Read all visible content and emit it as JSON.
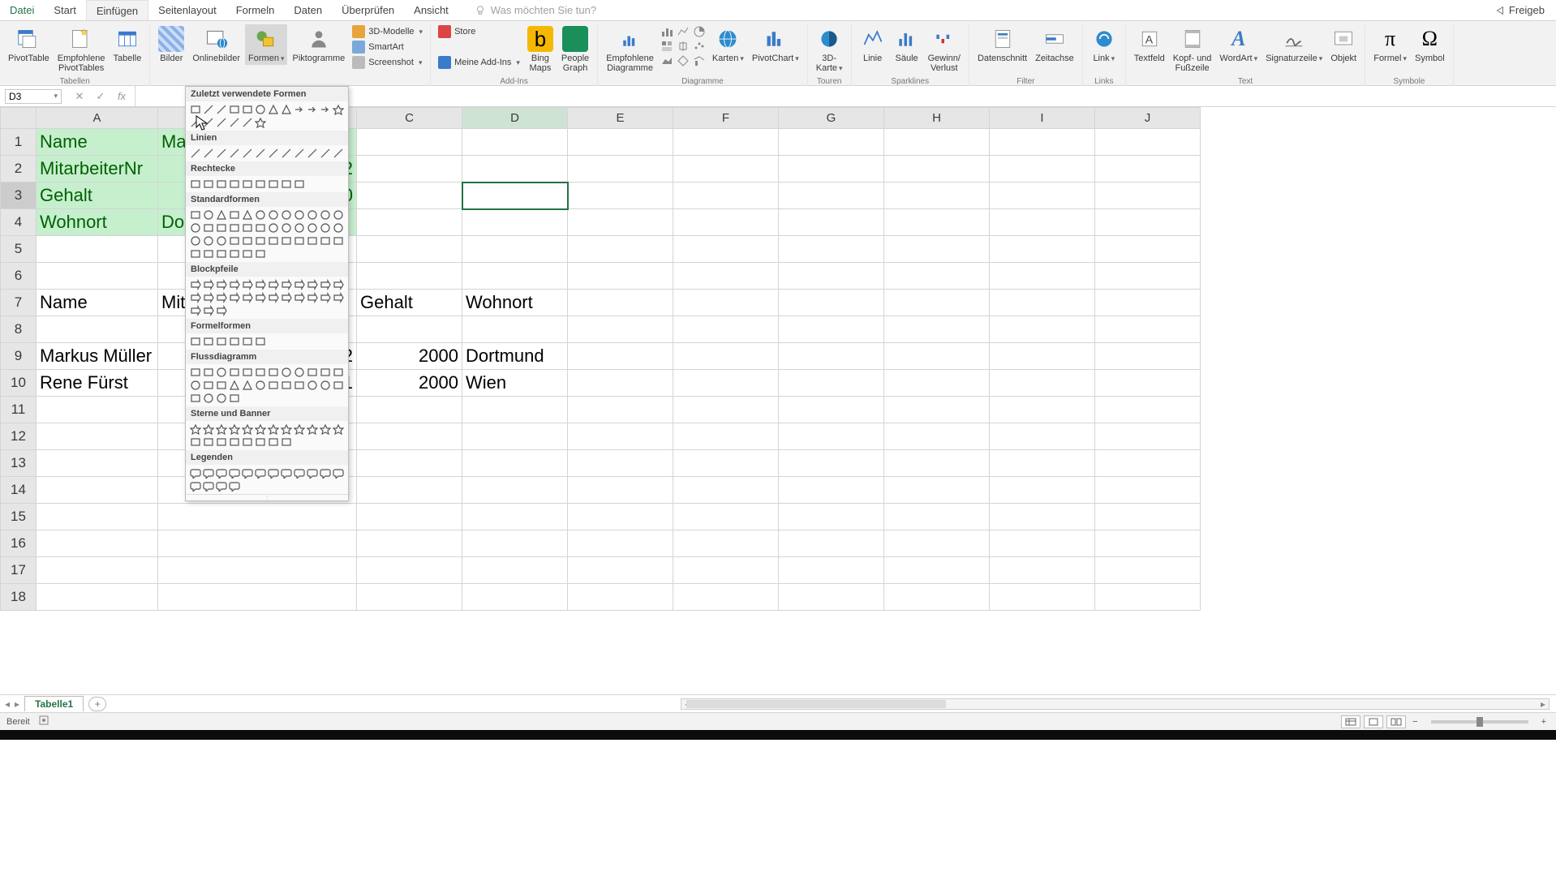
{
  "tabs": {
    "file": "Datei",
    "start": "Start",
    "insert": "Einfügen",
    "page_layout": "Seitenlayout",
    "formulas": "Formeln",
    "data": "Daten",
    "review": "Überprüfen",
    "view": "Ansicht"
  },
  "tell_me_placeholder": "Was möchten Sie tun?",
  "share_label": "Freigeb",
  "ribbon": {
    "tables": {
      "pivot": "PivotTable",
      "recommended": "Empfohlene\nPivotTables",
      "table": "Tabelle",
      "group": "Tabellen"
    },
    "illustrations": {
      "pictures": "Bilder",
      "online": "Onlinebilder",
      "shapes": "Formen",
      "icons": "Piktogramme",
      "models3d": "3D-Modelle",
      "smartart": "SmartArt",
      "screenshot": "Screenshot"
    },
    "addins": {
      "store": "Store",
      "my_addins": "Meine Add-Ins",
      "bing": "Bing\nMaps",
      "people": "People\nGraph",
      "group": "Add-Ins"
    },
    "charts": {
      "recommended": "Empfohlene\nDiagramme",
      "maps": "Karten",
      "pivotchart": "PivotChart",
      "group": "Diagramme"
    },
    "tours": {
      "map3d": "3D-\nKarte",
      "group": "Touren"
    },
    "sparklines": {
      "line": "Linie",
      "column": "Säule",
      "winloss": "Gewinn/\nVerlust",
      "group": "Sparklines"
    },
    "filter": {
      "slicer": "Datenschnitt",
      "timeline": "Zeitachse",
      "group": "Filter"
    },
    "links": {
      "link": "Link",
      "group": "Links"
    },
    "text": {
      "textbox": "Textfeld",
      "header": "Kopf- und\nFußzeile",
      "wordart": "WordArt",
      "sig": "Signaturzeile",
      "object": "Objekt",
      "group": "Text"
    },
    "symbols": {
      "equation": "Formel",
      "symbol": "Symbol",
      "group": "Symbole"
    }
  },
  "name_box": "D3",
  "columns": [
    "A",
    "B",
    "C",
    "D",
    "E",
    "F",
    "G",
    "H",
    "I",
    "J"
  ],
  "rows": [
    "1",
    "2",
    "3",
    "4",
    "5",
    "6",
    "7",
    "8",
    "9",
    "10",
    "11",
    "12",
    "13",
    "14",
    "15",
    "16",
    "17",
    "18"
  ],
  "cells": {
    "A1": "Name",
    "B1": "Ma",
    "A2": "MitarbeiterNr",
    "C2_suffix": "2",
    "A3": "Gehalt",
    "C3_suffix": "0",
    "A4": "Wohnort",
    "B4": "Do",
    "A7": "Name",
    "B7": "Mit",
    "C7": "Gehalt",
    "D7": "Wohnort",
    "A9": "Markus Müller",
    "C9_suffix": "2",
    "C9": "2000",
    "D9": "Dortmund",
    "A10": "Rene Fürst",
    "C10_suffix": "1",
    "C10": "2000",
    "D10": "Wien"
  },
  "shapes_panel": {
    "cat_recent": "Zuletzt verwendete Formen",
    "cat_lines": "Linien",
    "cat_rectangles": "Rechtecke",
    "cat_basic": "Standardformen",
    "cat_block": "Blockpfeile",
    "cat_equation": "Formelformen",
    "cat_flow": "Flussdiagramm",
    "cat_stars": "Sterne und Banner",
    "cat_callouts": "Legenden"
  },
  "sheet_tab": "Tabelle1",
  "status": "Bereit"
}
